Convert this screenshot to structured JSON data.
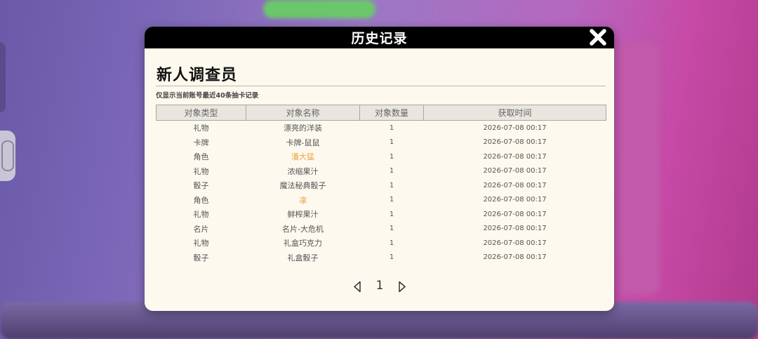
{
  "dialog": {
    "title": "历史记录",
    "heading": "新人调查员",
    "note": "仅显示当前账号最近40条抽卡记录"
  },
  "table": {
    "headers": [
      "对象类型",
      "对象名称",
      "对象数量",
      "获取时间"
    ],
    "rows": [
      {
        "type": "礼物",
        "name": "漂亮的洋装",
        "count": "1",
        "time": "2026-07-08  00:17",
        "highlight": false
      },
      {
        "type": "卡牌",
        "name": "卡牌-鼠鼠",
        "count": "1",
        "time": "2026-07-08  00:17",
        "highlight": false
      },
      {
        "type": "角色",
        "name": "潘大猛",
        "count": "1",
        "time": "2026-07-08  00:17",
        "highlight": true
      },
      {
        "type": "礼物",
        "name": "浓缩果汁",
        "count": "1",
        "time": "2026-07-08  00:17",
        "highlight": false
      },
      {
        "type": "骰子",
        "name": "魔法秘典骰子",
        "count": "1",
        "time": "2026-07-08  00:17",
        "highlight": false
      },
      {
        "type": "角色",
        "name": "凛",
        "count": "1",
        "time": "2026-07-08  00:17",
        "highlight": true
      },
      {
        "type": "礼物",
        "name": "鲜榨果汁",
        "count": "1",
        "time": "2026-07-08  00:17",
        "highlight": false
      },
      {
        "type": "名片",
        "name": "名片-大危机",
        "count": "1",
        "time": "2026-07-08  00:17",
        "highlight": false
      },
      {
        "type": "礼物",
        "name": "礼盒巧克力",
        "count": "1",
        "time": "2026-07-08  00:17",
        "highlight": false
      },
      {
        "type": "骰子",
        "name": "礼盒骰子",
        "count": "1",
        "time": "2026-07-08  00:17",
        "highlight": false
      }
    ]
  },
  "pager": {
    "current_page": "1",
    "prev_icon": "triangle-left-outline",
    "next_icon": "triangle-right-outline"
  },
  "colors": {
    "highlight": "#f0a24a",
    "panel_bg": "#fdf9ee",
    "titlebar_bg": "#000000"
  }
}
